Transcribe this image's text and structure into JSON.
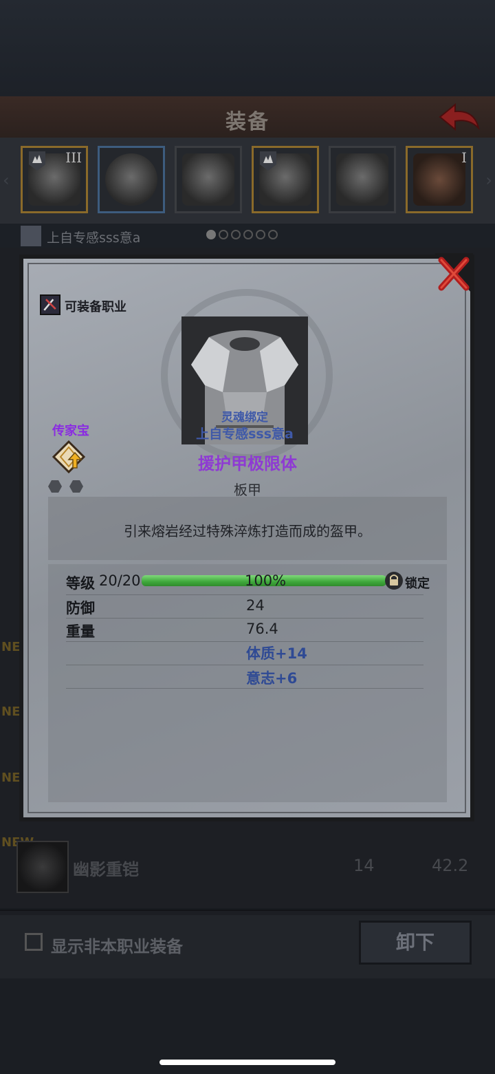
{
  "header": {
    "title": "装备"
  },
  "slots": [
    {
      "roman": "III"
    },
    {
      "roman": ""
    },
    {
      "roman": ""
    },
    {
      "roman": ""
    },
    {
      "roman": ""
    },
    {
      "roman": "I"
    }
  ],
  "character": {
    "name": "上自专感sss意a"
  },
  "list": {
    "new_badge": "NEW",
    "visible_item": {
      "name": "幽影重铠",
      "defense": "14",
      "weight": "42.2"
    }
  },
  "footer": {
    "show_other_class_label": "显示非本职业装备",
    "unequip_label": "卸下"
  },
  "modal": {
    "class_label": "可装备职业",
    "soul_bound": "灵魂绑定",
    "owner": "上自专感sss意a",
    "heirloom_label": "传家宝",
    "item_name": "援护甲极限体",
    "item_type": "板甲",
    "description": "引来熔岩经过特殊淬炼打造而成的盔甲。",
    "stats": {
      "level_label": "等级",
      "level_value": "20/20",
      "progress_percent": "100%",
      "progress_fraction": 1.0,
      "lock_label": "锁定",
      "defense_label": "防御",
      "defense_value": "24",
      "weight_label": "重量",
      "weight_value": "76.4",
      "bonus_1": "体质+14",
      "bonus_2": "意志+6"
    }
  }
}
